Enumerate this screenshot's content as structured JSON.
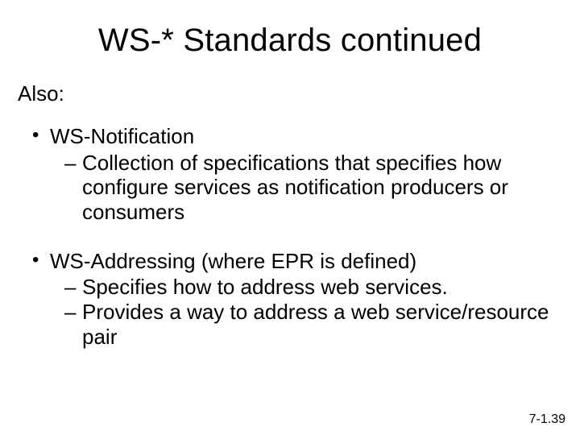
{
  "title": "WS-* Standards continued",
  "intro": "Also:",
  "bullets": [
    {
      "label": "WS-Notification",
      "sub": [
        "Collection of specifications that specifies how configure services as notification producers or consumers"
      ]
    },
    {
      "label": "WS-Addressing  (where EPR is defined)",
      "sub": [
        "Specifies how to address web services.",
        "Provides a way to address a web service/resource pair"
      ]
    }
  ],
  "footer": "7-1.39"
}
